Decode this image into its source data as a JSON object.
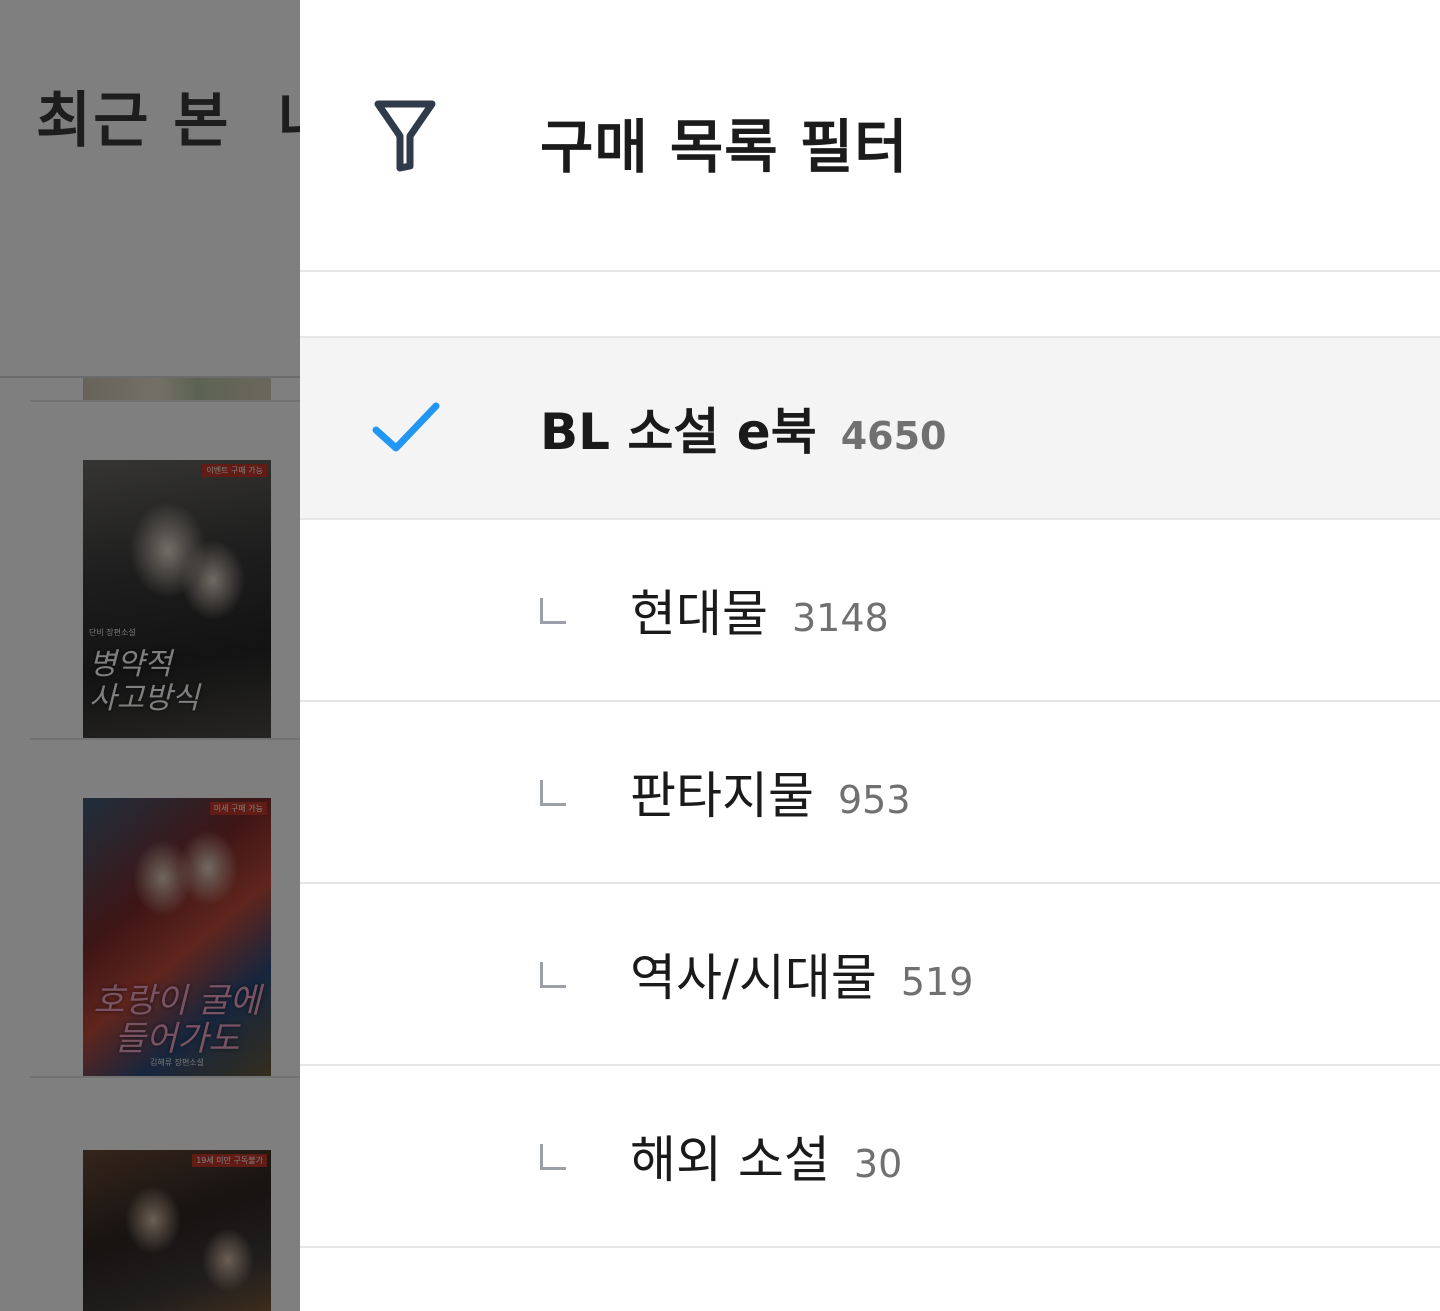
{
  "background": {
    "tabs": [
      "최근 본",
      "나"
    ],
    "books": [
      {
        "badge": "이벤트 구매 가능",
        "title_line1": "병약적",
        "title_line2": "사고방식",
        "author": "단비 장편소설"
      },
      {
        "badge": "미세 구매 가능",
        "title_line1": "호랑이 굴에",
        "title_line2": "들어가도",
        "author": "김해류 장편소설"
      },
      {
        "badge": "19세 미만 구독불가"
      }
    ]
  },
  "drawer": {
    "title": "구매 목록 필터",
    "filter_icon": "filter-funnel-icon",
    "check_icon": "checkmark-icon",
    "check_color": "#2196f3",
    "items": [
      {
        "label": "BL 소설 e북",
        "count": "4650",
        "selected": true
      },
      {
        "label": "현대물",
        "count": "3148",
        "selected": false
      },
      {
        "label": "판타지물",
        "count": "953",
        "selected": false
      },
      {
        "label": "역사/시대물",
        "count": "519",
        "selected": false
      },
      {
        "label": "해외 소설",
        "count": "30",
        "selected": false
      }
    ]
  }
}
